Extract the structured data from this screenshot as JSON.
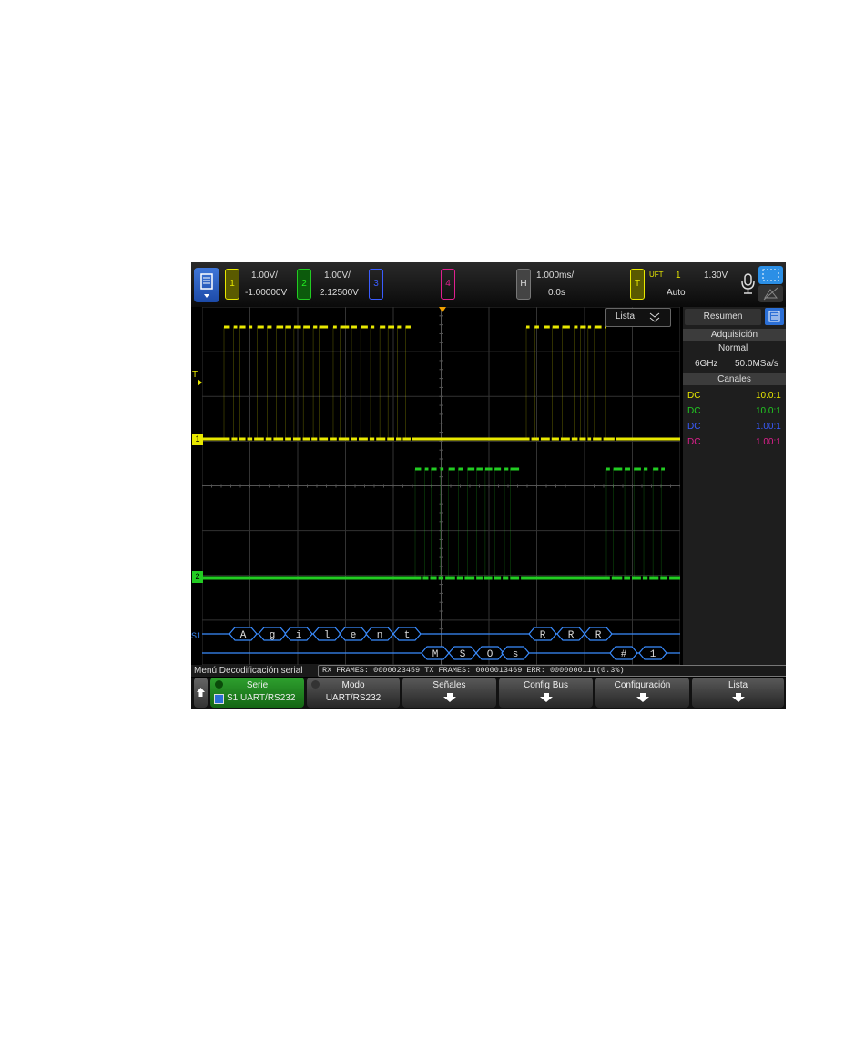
{
  "topbar": {
    "ch1": {
      "num": "1",
      "scale": "1.00V/",
      "offset": "-1.00000V",
      "color": "#e8e800"
    },
    "ch2": {
      "num": "2",
      "scale": "1.00V/",
      "offset": "2.12500V",
      "color": "#22cc22"
    },
    "ch3": {
      "num": "3",
      "color": "#3a5cff"
    },
    "ch4": {
      "num": "4",
      "color": "#e0208f"
    },
    "horizontal": {
      "label": "H",
      "scale": "1.000ms/",
      "delay": "0.0s"
    },
    "trigger": {
      "label": "T",
      "type": "UFT",
      "source": "1",
      "level": "1.30V",
      "mode": "Auto"
    }
  },
  "display": {
    "list_button": "Lista",
    "trigger_marker": "T",
    "ch1_marker": "1",
    "ch2_marker": "2",
    "serial_marker": "S1"
  },
  "decode": {
    "rx_bytes": [
      "A",
      "g",
      "i",
      "l",
      "e",
      "n",
      "t",
      "R",
      "R",
      "R"
    ],
    "tx_bytes": [
      "M",
      "S",
      "O",
      "s",
      "#",
      "1"
    ]
  },
  "right_panel": {
    "tab": "Resumen",
    "acq_header": "Adquisición",
    "acq_mode": "Normal",
    "bandwidth": "6GHz",
    "sample_rate": "50.0MSa/s",
    "channels_header": "Canales",
    "channels": [
      {
        "coupling": "DC",
        "probe": "10.0:1",
        "color": "#e8e800"
      },
      {
        "coupling": "DC",
        "probe": "10.0:1",
        "color": "#22cc22"
      },
      {
        "coupling": "DC",
        "probe": "1.00:1",
        "color": "#3a5cff"
      },
      {
        "coupling": "DC",
        "probe": "1.00:1",
        "color": "#e0208f"
      }
    ]
  },
  "status": {
    "menu_title": "Menú Decodificación serial",
    "frames": "RX FRAMES: 0000023459  TX FRAMES: 0000013469  ERR: 0000000111(0.3%)"
  },
  "softkeys": {
    "serie_label": "Serie",
    "serie_value": "S1  UART/RS232",
    "modo_label": "Modo",
    "modo_value": "UART/RS232",
    "senales": "Señales",
    "config_bus": "Config Bus",
    "configuracion": "Configuración",
    "lista": "Lista"
  },
  "colors": {
    "ch1": "#e8e800",
    "ch2": "#22cc22",
    "bus": "#3a8cff",
    "softkey_active": "#1e8a1e"
  }
}
